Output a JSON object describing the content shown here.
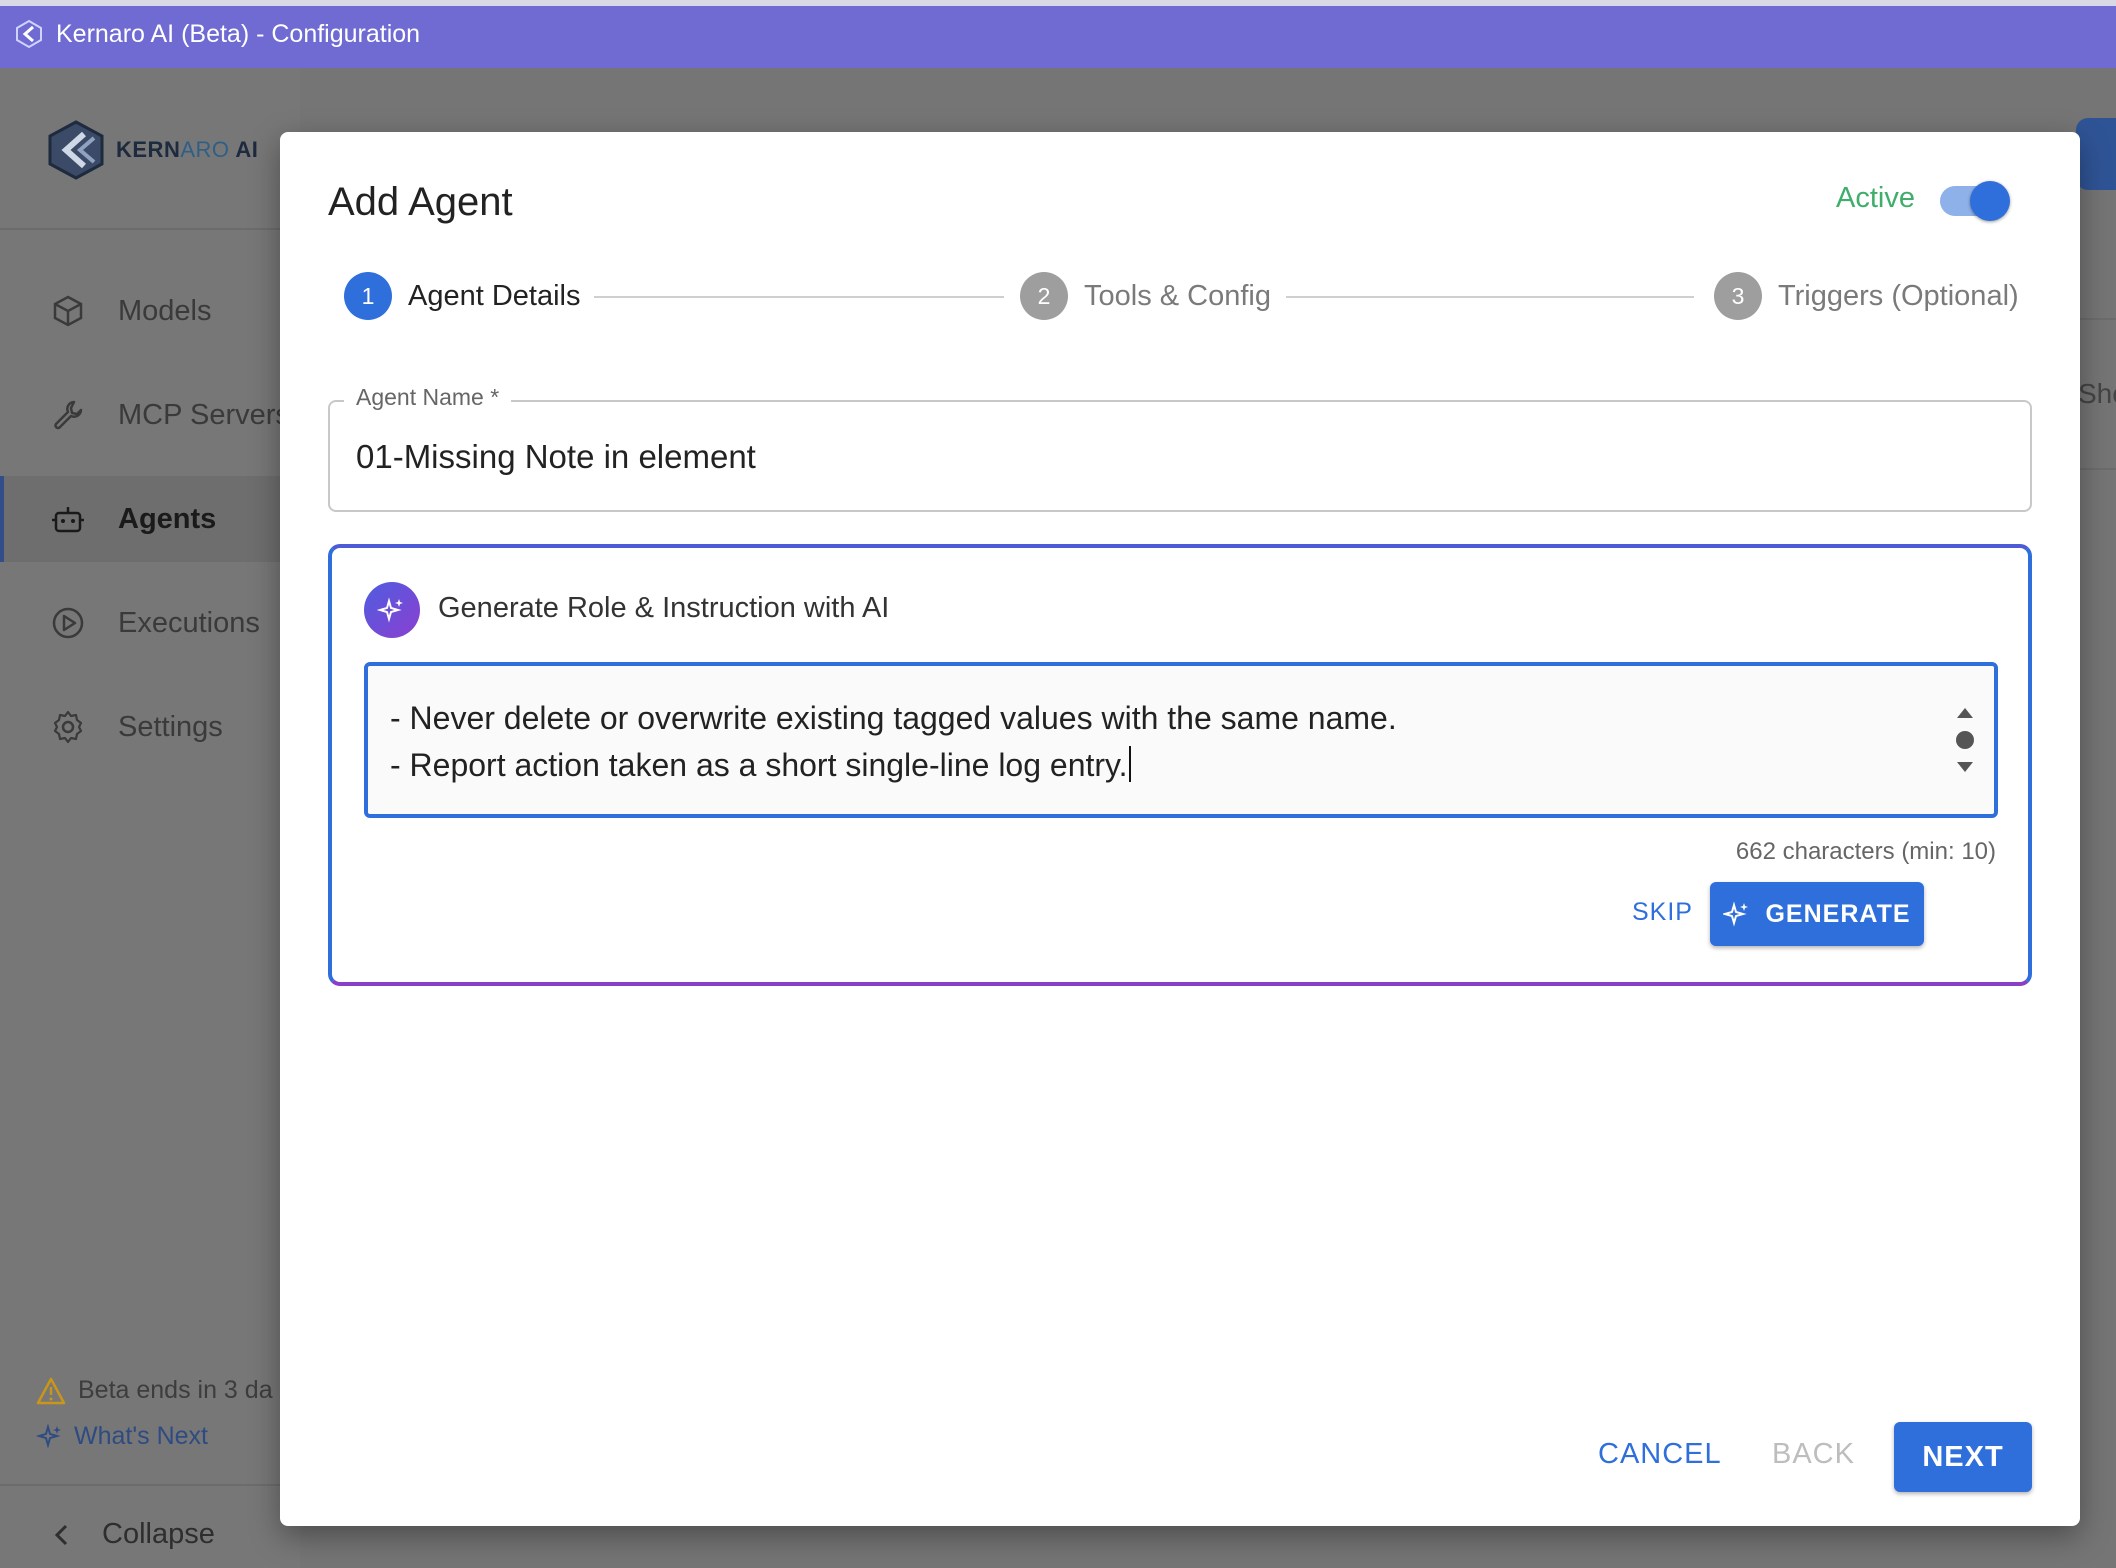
{
  "window": {
    "title": "Kernaro AI (Beta) - Configuration"
  },
  "sidebar": {
    "logo": {
      "main": "KERN",
      "accent": "ARO",
      "suffix": "AI"
    },
    "items": [
      {
        "label": "Models",
        "icon": "cube-icon"
      },
      {
        "label": "MCP Servers",
        "icon": "wrench-icon"
      },
      {
        "label": "Agents",
        "icon": "robot-icon",
        "active": true
      },
      {
        "label": "Executions",
        "icon": "play-circle-icon"
      },
      {
        "label": "Settings",
        "icon": "gear-icon"
      }
    ],
    "beta_notice": "Beta ends in 3 da",
    "whats_next": "What's Next",
    "collapse": "Collapse"
  },
  "background": {
    "cut_text": "Sho"
  },
  "dialog": {
    "title": "Add Agent",
    "active_label": "Active",
    "active": true,
    "steps": [
      {
        "num": "1",
        "label": "Agent Details",
        "current": true
      },
      {
        "num": "2",
        "label": "Tools & Config",
        "current": false
      },
      {
        "num": "3",
        "label": "Triggers (Optional)",
        "current": false
      }
    ],
    "agent_name": {
      "label": "Agent Name *",
      "value": "01-Missing Note in element"
    },
    "ai": {
      "title": "Generate Role & Instruction with AI",
      "lines": [
        "- Never delete or overwrite existing tagged values with the same name.",
        "- Report action taken as a short single-line log entry."
      ],
      "char_count": "662 characters (min: 10)",
      "skip_label": "SKIP",
      "generate_label": "GENERATE"
    },
    "footer": {
      "cancel": "CANCEL",
      "back": "BACK",
      "next": "NEXT"
    }
  },
  "colors": {
    "title_bar": "#6f6bd3",
    "primary": "#2f6fdc",
    "active_green": "#3fae6b",
    "ai_gradient_start": "#4f5de0",
    "ai_gradient_end": "#8b3fd0"
  }
}
